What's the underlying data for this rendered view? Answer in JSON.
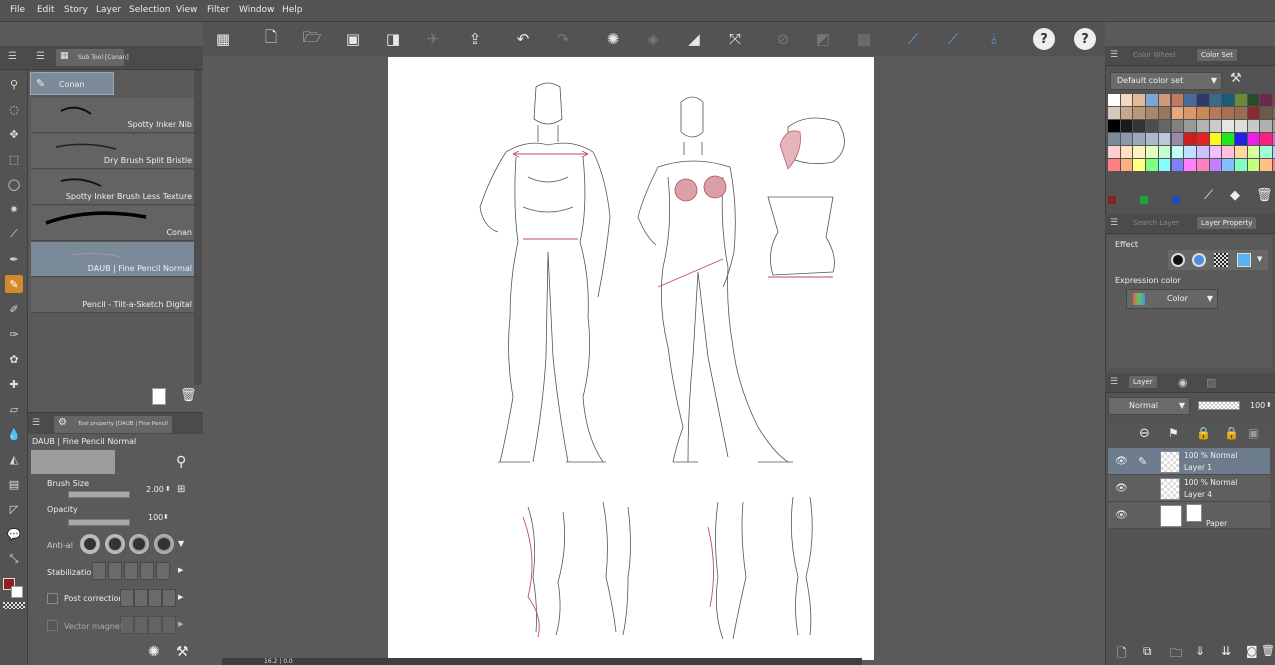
{
  "menu": [
    "File",
    "Edit",
    "Story",
    "Layer",
    "Selection",
    "View",
    "Filter",
    "Window",
    "Help"
  ],
  "subtool_panel": {
    "tab_label": "Sub Tool [Conan]",
    "group_label": "Conan",
    "brushes": [
      {
        "label": "Spotty Inker Nib",
        "selected": false
      },
      {
        "label": "Dry Brush Split Bristle",
        "selected": false
      },
      {
        "label": "Spotty Inker Brush Less Texture",
        "selected": false
      },
      {
        "label": "Conan",
        "selected": false
      },
      {
        "label": "DAUB | Fine Pencil Normal",
        "selected": true
      },
      {
        "label": "Pencil - Tilt-a-Sketch Digital",
        "selected": false
      }
    ]
  },
  "tool_property": {
    "tab_label": "Tool property [DAUB | Fine Pencil N",
    "tool_name": "DAUB | Fine Pencil Normal",
    "brush_size_label": "Brush Size",
    "brush_size_value": "2.00",
    "opacity_label": "Opacity",
    "opacity_value": "100",
    "antialias_label": "Anti-al",
    "stabilization_label": "Stabilization",
    "post_correction_label": "Post correction",
    "vector_magnet_label": "Vector magnet"
  },
  "color_panel": {
    "tab_wheel": "Color Wheel",
    "tab_set": "Color Set",
    "set_name": "Default color set",
    "swatches": [
      [
        "#ffffff",
        "#f2d7c7",
        "#e6b89a",
        "#7aa7d8",
        "#d49a78",
        "#c07a60",
        "#4a6a9a",
        "#2a3a6a",
        "#3a6a8a",
        "#1a5a7a",
        "#6a8a3a",
        "#2a4a2a",
        "#6a2a4a",
        "#8a3a5a"
      ],
      [
        "#d8c8b8",
        "#c8a888",
        "#b89878",
        "#a88868",
        "#987858",
        "#e8a878",
        "#d89868",
        "#c88858",
        "#b8785a",
        "#a87050",
        "#987050",
        "#8a2a2a",
        "#6a5a4a",
        "#7a6a5a"
      ],
      [
        "#000000",
        "#1a1a1a",
        "#333333",
        "#4d4d4d",
        "#666666",
        "#808080",
        "#999999",
        "#b3b3b3",
        "#cccccc",
        "#e6e6e6",
        "#dddddd",
        "#c8c8c8",
        "#b0b0b0",
        "#a0a0a0"
      ],
      [
        "#7a8a9a",
        "#8a9aaa",
        "#9aaaba",
        "#aabaca",
        "#bac8d8",
        "#9a8aaa",
        "#c82020",
        "#e82020",
        "#f8f820",
        "#20e820",
        "#2020e8",
        "#e820e8",
        "#f82080",
        "#e060e0"
      ],
      [
        "#ffd0d0",
        "#ffe0c0",
        "#fff0c0",
        "#e0ffc0",
        "#c0ffd0",
        "#c0fff0",
        "#c0e0ff",
        "#d0c0ff",
        "#f0c0ff",
        "#ffc0e0",
        "#ffd8a0",
        "#d8ffa0",
        "#a0ffd8",
        "#a0d8ff"
      ],
      [
        "#ff8080",
        "#ffb080",
        "#ffff80",
        "#80ff80",
        "#80ffff",
        "#8080ff",
        "#ff80ff",
        "#ff80c0",
        "#c080ff",
        "#80c0ff",
        "#80ffc0",
        "#c0ff80",
        "#ffc080",
        "#ff8080"
      ]
    ],
    "bottom_colors": [
      "#8a2020",
      "#20a040",
      "#2050c0"
    ]
  },
  "layer_property": {
    "tab_search": "Search Layer",
    "tab_prop": "Layer Property",
    "effect_label": "Effect",
    "expression_label": "Expression color",
    "expression_value": "Color"
  },
  "layers": {
    "tab_label": "Layer",
    "blend_mode": "Normal",
    "opacity": "100",
    "items": [
      {
        "mode": "100 %  Normal",
        "name": "Layer 1",
        "selected": true
      },
      {
        "mode": "100 %  Normal",
        "name": "Layer 4",
        "selected": false
      },
      {
        "mode": "",
        "name": "Paper",
        "selected": false
      }
    ]
  },
  "status": {
    "zoom": "16.2 | 0.0"
  },
  "accent": "#d48a2c"
}
